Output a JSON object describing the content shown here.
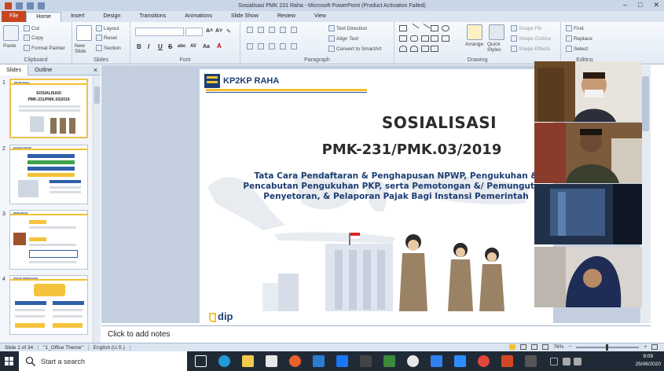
{
  "window": {
    "title": "Sosialisasi PMK 231 Raha - Microsoft PowerPoint (Product Activation Failed)",
    "controls": [
      "–",
      "□",
      "✕"
    ]
  },
  "tabs": [
    "File",
    "Home",
    "Insert",
    "Design",
    "Transitions",
    "Animations",
    "Slide Show",
    "Review",
    "View"
  ],
  "active_tab": "Home",
  "ribbon": {
    "clipboard": {
      "label": "Clipboard",
      "paste": "Paste",
      "cut": "Cut",
      "copy": "Copy",
      "format_painter": "Format Painter"
    },
    "slides": {
      "label": "Slides",
      "new_slide": "New Slide",
      "layout": "Layout",
      "reset": "Reset",
      "section": "Section"
    },
    "font": {
      "label": "Font",
      "bold": "B",
      "italic": "I",
      "underline": "U",
      "strike": "S",
      "shadow": "abc",
      "spacing": "AV",
      "case": "Aa",
      "grow": "A˄",
      "shrink": "A˅"
    },
    "paragraph": {
      "label": "Paragraph",
      "text_direction": "Text Direction",
      "align_text": "Align Text",
      "smartart": "Convert to SmartArt"
    },
    "drawing": {
      "label": "Drawing",
      "arrange": "Arrange",
      "quick_styles": "Quick Styles",
      "shape_fill": "Shape Fill",
      "shape_outline": "Shape Outline",
      "shape_effects": "Shape Effects"
    },
    "editing": {
      "label": "Editing",
      "find": "Find",
      "replace": "Replace",
      "select": "Select"
    }
  },
  "left_pane": {
    "tabs": [
      "Slides",
      "Outline"
    ],
    "close": "×"
  },
  "thumbnails": [
    {
      "num": "1",
      "selected": true,
      "header": "KP2KP RAHA",
      "title": "SOSIALISASI",
      "subtitle": "PMK-231/PMK.03/2019"
    },
    {
      "num": "2",
      "selected": false,
      "header": "DASAR HUKUM",
      "title": "",
      "subtitle": ""
    },
    {
      "num": "3",
      "selected": false,
      "header": "KEWAJIBAN",
      "title": "",
      "subtitle": ""
    },
    {
      "num": "4",
      "selected": false,
      "header": "POKOK PERUBAHAN",
      "title": "",
      "subtitle": ""
    }
  ],
  "slide": {
    "header": "KP2KP RAHA",
    "title": "SOSIALISASI",
    "subtitle": "PMK-231/PMK.03/2019",
    "description": "Tata Cara Pendaftaran & Penghapusan NPWP, Pengukuhan & Pencabutan Pengukuhan PKP, serta Pemotongan &/ Pemungutan, Penyetoran, & Pelaporan Pajak Bagi Instansi Pemerintah",
    "footer_logo": "dip"
  },
  "notes": {
    "placeholder": "Click to add notes"
  },
  "status": {
    "slide": "Slide 1 of 34",
    "theme": "\"1_Office Theme\"",
    "language": "English (U.S.)",
    "zoom": "76%"
  },
  "taskbar": {
    "search_placeholder": "Start a search",
    "time": "9:09",
    "date": "25/06/2020"
  },
  "colors": {
    "accent_yellow": "#f4c030",
    "navy": "#1d3e75",
    "file_tab": "#c8461f",
    "ribbon_bg": "#dbe5f1",
    "taskbar": "#1f2a36"
  }
}
